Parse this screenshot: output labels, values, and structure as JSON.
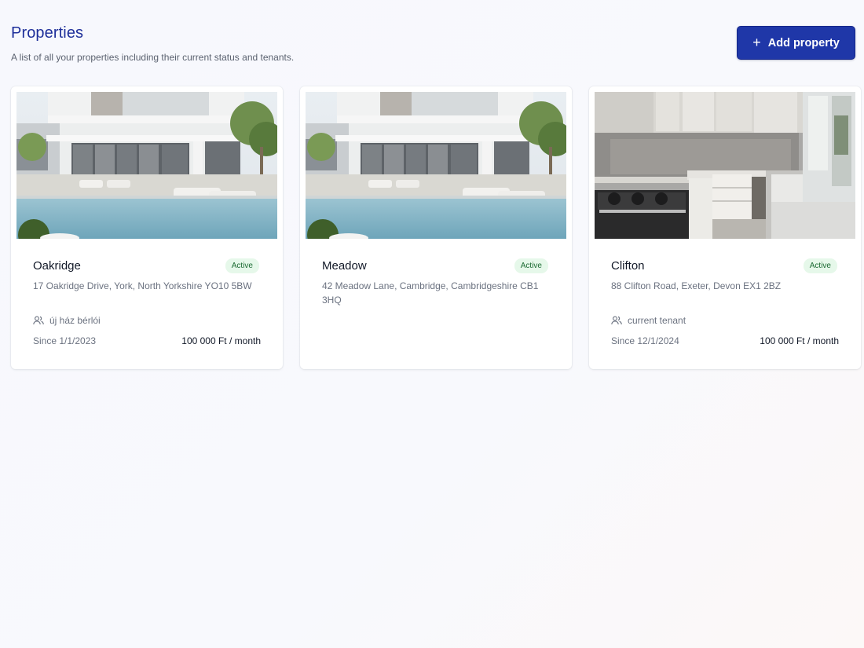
{
  "header": {
    "title": "Properties",
    "subtitle": "A list of all your properties including their current status and tenants.",
    "add_button_label": "Add property"
  },
  "accent_color": "#1f37a8",
  "properties": [
    {
      "name": "Oakridge",
      "status": "Active",
      "address": "17 Oakridge Drive, York, North Yorkshire YO10 5BW",
      "tenant": "új ház bérlói",
      "since": "Since 1/1/2023",
      "price": "100 000 Ft / month",
      "image": "modern-villa-with-pool"
    },
    {
      "name": "Meadow",
      "status": "Active",
      "address": "42 Meadow Lane, Cambridge, Cambridgeshire CB1 3HQ",
      "image": "modern-villa-with-pool"
    },
    {
      "name": "Clifton",
      "status": "Active",
      "address": "88 Clifton Road, Exeter, Devon EX1 2BZ",
      "tenant": "current tenant",
      "since": "Since 12/1/2024",
      "price": "100 000 Ft / month",
      "image": "kitchen-interior"
    }
  ]
}
